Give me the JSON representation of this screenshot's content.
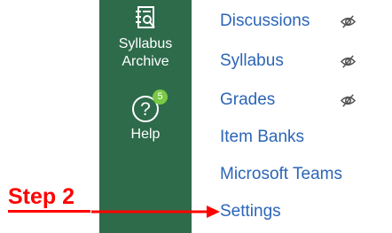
{
  "global_nav": {
    "syllabus_archive": {
      "label_line1": "Syllabus",
      "label_line2": "Archive",
      "icon": "syllabus-archive-icon"
    },
    "help": {
      "label": "Help",
      "icon": "help-icon",
      "badge": "5",
      "badge_color": "#7ac943"
    },
    "background_color": "#2d6b4b"
  },
  "course_nav": {
    "link_color": "#2b65b7",
    "items": [
      {
        "label": "Discussions",
        "hidden_from_students": true
      },
      {
        "label": "Syllabus",
        "hidden_from_students": true
      },
      {
        "label": "Grades",
        "hidden_from_students": true
      },
      {
        "label": "Item Banks",
        "hidden_from_students": false
      },
      {
        "label": "Microsoft Teams",
        "hidden_from_students": false
      },
      {
        "label": "Settings",
        "hidden_from_students": false
      }
    ]
  },
  "annotation": {
    "label": "Step 2",
    "color": "#ff0000"
  }
}
